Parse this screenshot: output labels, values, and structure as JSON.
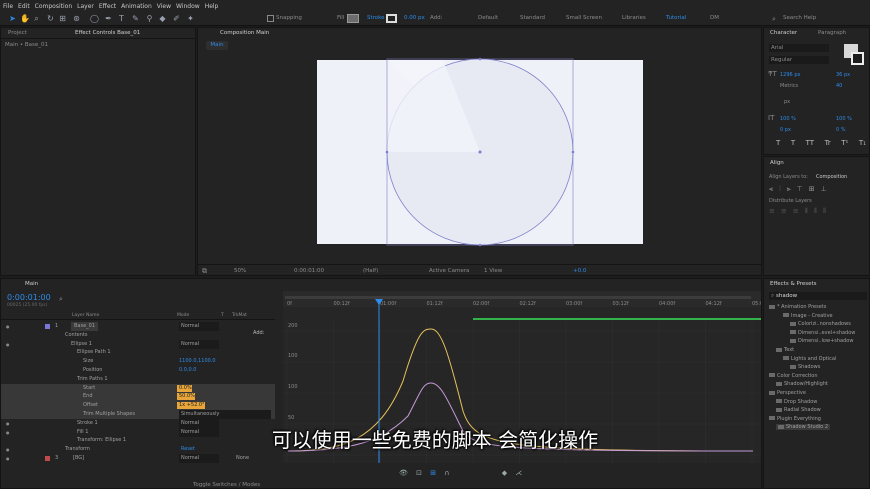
{
  "menu": [
    "File",
    "Edit",
    "Composition",
    "Layer",
    "Effect",
    "Animation",
    "View",
    "Window",
    "Help"
  ],
  "toolbar": {
    "snapping": "Snapping",
    "fill": "Fill",
    "stroke": "Stroke",
    "stroke_width": "0.00 px",
    "add": "Add:",
    "workspaces": [
      "Default",
      "Standard",
      "Small Screen",
      "Libraries",
      "Tutorial",
      "DM"
    ],
    "active_workspace": "Tutorial",
    "search_placeholder": "Search Help"
  },
  "project": {
    "tab_project": "Project",
    "tab_effect_controls": "Effect Controls Base_01",
    "breadcrumb": "Main • Base_01"
  },
  "composition": {
    "tab": "Composition Main",
    "subtab": "Main",
    "zoom": "50%",
    "timecode": "0:00:01:00",
    "resolution": "(Half)",
    "camera": "Active Camera",
    "view": "1 View",
    "exposure": "+0.0"
  },
  "character": {
    "tab_character": "Character",
    "tab_paragraph": "Paragraph",
    "font": "Arial",
    "style": "Regular",
    "size": "1296 px",
    "leading": "36 px",
    "kerning": "Metrics",
    "tracking": "40",
    "stroke_unit": "px",
    "vscale": "100 %",
    "hscale": "100 %",
    "baseline": "0 px",
    "tsume": "0 %",
    "styles": [
      "T",
      "T",
      "TT",
      "Tr",
      "T¹",
      "T₁"
    ]
  },
  "align": {
    "tab": "Align",
    "align_to_label": "Align Layers to:",
    "align_to_value": "Composition",
    "distribute_label": "Distribute Layers"
  },
  "effects": {
    "tab": "Effects & Presets",
    "search": "shadow",
    "tree": [
      {
        "label": "* Animation Presets",
        "indent": 0
      },
      {
        "label": "Image - Creative",
        "indent": 2
      },
      {
        "label": "Colorizi..nonshadows",
        "indent": 3
      },
      {
        "label": "Dimensi..evel+shadow",
        "indent": 3
      },
      {
        "label": "Dimensi..low+shadow",
        "indent": 3
      },
      {
        "label": "Text",
        "indent": 1
      },
      {
        "label": "Lights and Optical",
        "indent": 2
      },
      {
        "label": "Shadows",
        "indent": 3
      },
      {
        "label": "Color Correction",
        "indent": 0
      },
      {
        "label": "Shadow/Highlight",
        "indent": 1
      },
      {
        "label": "Perspective",
        "indent": 0
      },
      {
        "label": "Drop Shadow",
        "indent": 1
      },
      {
        "label": "Radial Shadow",
        "indent": 1
      },
      {
        "label": "Plugin Everything",
        "indent": 0
      },
      {
        "label": "Shadow Studio 2",
        "indent": 1
      }
    ]
  },
  "timeline": {
    "tab": "Main",
    "timecode": "0:00:01:00",
    "fps": "00025 (25.00 fps)",
    "col_layer_name": "Layer Name",
    "col_mode": "Mode",
    "col_t": "T",
    "col_trkmat": "TrkMat",
    "add": "Add:",
    "layers": [
      {
        "num": "1",
        "name": "Base_01",
        "mode": "Normal",
        "indent": 0,
        "highlight": false,
        "value": ""
      },
      {
        "num": "",
        "name": "Contents",
        "mode": "",
        "indent": 1,
        "highlight": false,
        "value": ""
      },
      {
        "num": "",
        "name": "Ellipse 1",
        "mode": "Normal",
        "indent": 2,
        "highlight": false,
        "value": ""
      },
      {
        "num": "",
        "name": "Ellipse Path 1",
        "mode": "",
        "indent": 3,
        "highlight": false,
        "value": ""
      },
      {
        "num": "",
        "name": "Size",
        "mode": "",
        "indent": 4,
        "highlight": false,
        "value": "1100.0,1100.0"
      },
      {
        "num": "",
        "name": "Position",
        "mode": "",
        "indent": 4,
        "highlight": false,
        "value": "0.0,0.0"
      },
      {
        "num": "",
        "name": "Trim Paths 1",
        "mode": "",
        "indent": 3,
        "highlight": false,
        "value": ""
      },
      {
        "num": "",
        "name": "Start",
        "mode": "",
        "indent": 4,
        "highlight": true,
        "value": "0.0%"
      },
      {
        "num": "",
        "name": "End",
        "mode": "",
        "indent": 4,
        "highlight": true,
        "value": "50.0%"
      },
      {
        "num": "",
        "name": "Offset",
        "mode": "",
        "indent": 4,
        "highlight": true,
        "value": "1x +52.0°"
      },
      {
        "num": "",
        "name": "Trim Multiple Shapes",
        "mode": "Simultaneously",
        "indent": 4,
        "highlight": true,
        "value": ""
      },
      {
        "num": "",
        "name": "Stroke 1",
        "mode": "Normal",
        "indent": 3,
        "highlight": false,
        "value": ""
      },
      {
        "num": "",
        "name": "Fill 1",
        "mode": "Normal",
        "indent": 3,
        "highlight": false,
        "value": ""
      },
      {
        "num": "",
        "name": "Transform: Ellipse 1",
        "mode": "",
        "indent": 3,
        "highlight": false,
        "value": ""
      },
      {
        "num": "",
        "name": "Transform",
        "mode": "Reset",
        "indent": 1,
        "highlight": false,
        "value": ""
      },
      {
        "num": "3",
        "name": "[BG]",
        "mode": "Normal",
        "indent": 0,
        "highlight": false,
        "value": "None"
      }
    ],
    "ruler": [
      "0f",
      "00:12f",
      "01:00f",
      "01:12f",
      "02:00f",
      "02:12f",
      "03:00f",
      "03:12f",
      "04:00f",
      "04:12f",
      "05:00f"
    ],
    "graph_labels": [
      "200",
      "100",
      "100",
      "50"
    ],
    "toggle": "Toggle Switches / Modes"
  },
  "subtitle": "可以使用一些免费的脚本 会简化操作",
  "colors": {
    "accent": "#2d8ceb",
    "curve_yellow": "#e8c35a",
    "curve_purple": "#c79ad8",
    "canvas": "#eff1f8",
    "work_green": "#33b24a"
  }
}
